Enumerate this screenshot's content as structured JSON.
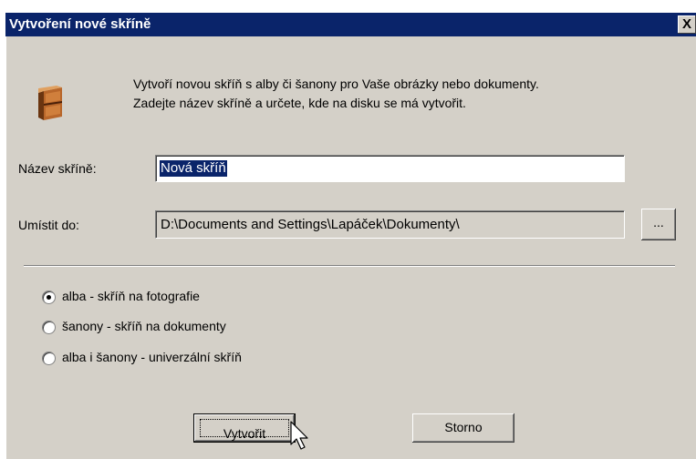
{
  "window": {
    "title": "Vytvoření nové skříně",
    "close_glyph": "X"
  },
  "description": {
    "line1": "Vytvoří novou skříň s alby či šanony pro Vaše obrázky nebo dokumenty.",
    "line2": "Zadejte název skříně a určete, kde na disku se má vytvořit."
  },
  "form": {
    "name_label": "Název skříně:",
    "name_value": "Nová skříň",
    "location_label": "Umístit do:",
    "location_value": "D:\\Documents and Settings\\Lapáček\\Dokumenty\\",
    "browse_label": "..."
  },
  "options": [
    {
      "label": "alba - skříň na fotografie",
      "selected": true
    },
    {
      "label": "šanony - skříň na dokumenty",
      "selected": false
    },
    {
      "label": "alba i šanony - univerzální skříň",
      "selected": false
    }
  ],
  "buttons": {
    "create": "Vytvořit",
    "cancel": "Storno"
  },
  "icons": {
    "cabinet": "cabinet-icon",
    "cursor": "mouse-cursor-icon"
  },
  "colors": {
    "titlebar": "#0a246a",
    "dialog_bg": "#d4d0c8",
    "selection": "#0a246a"
  }
}
